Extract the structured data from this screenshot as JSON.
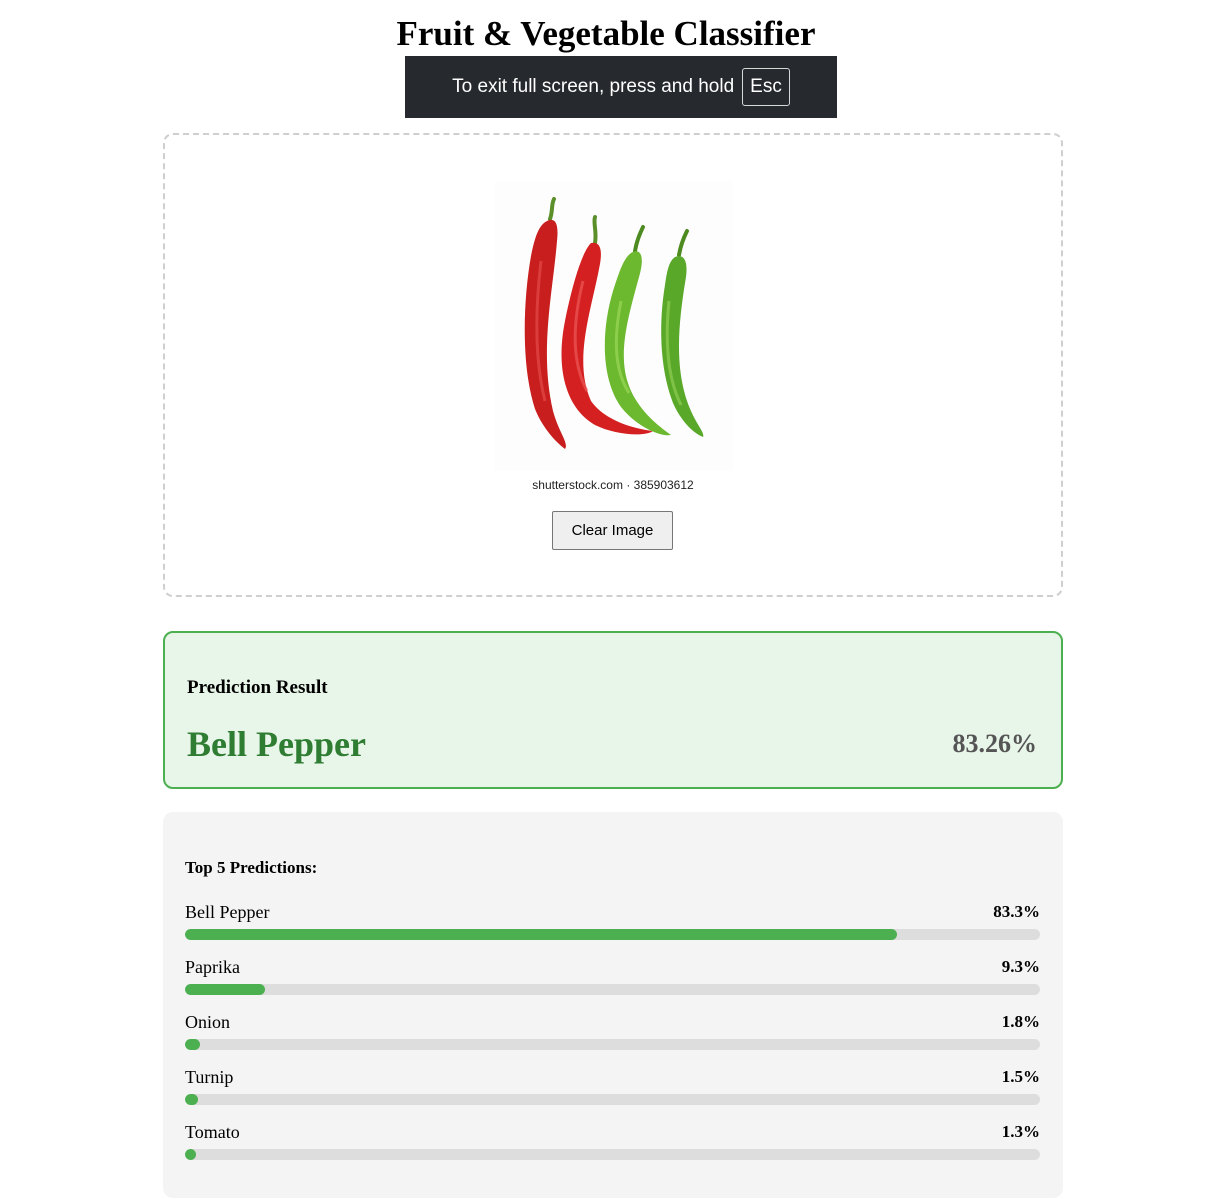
{
  "page": {
    "title": "Fruit & Vegetable Classifier"
  },
  "fullscreen_notice": {
    "text": "To exit full screen, press and hold",
    "key": "Esc"
  },
  "upload": {
    "image_watermark": "shutterstock.com · 385903612",
    "clear_button_label": "Clear Image"
  },
  "result": {
    "heading": "Prediction Result",
    "label": "Bell Pepper",
    "confidence": "83.26%"
  },
  "top_predictions": {
    "heading": "Top 5 Predictions:",
    "items": [
      {
        "name": "Bell Pepper",
        "percent_label": "83.3%",
        "value": 83.3
      },
      {
        "name": "Paprika",
        "percent_label": "9.3%",
        "value": 9.3
      },
      {
        "name": "Onion",
        "percent_label": "1.8%",
        "value": 1.8
      },
      {
        "name": "Turnip",
        "percent_label": "1.5%",
        "value": 1.5
      },
      {
        "name": "Tomato",
        "percent_label": "1.3%",
        "value": 1.3
      }
    ]
  },
  "colors": {
    "accent_green": "#4caf50",
    "result_text_green": "#2e7d32",
    "result_background": "#e8f5e9",
    "toast_background": "#26292e"
  }
}
